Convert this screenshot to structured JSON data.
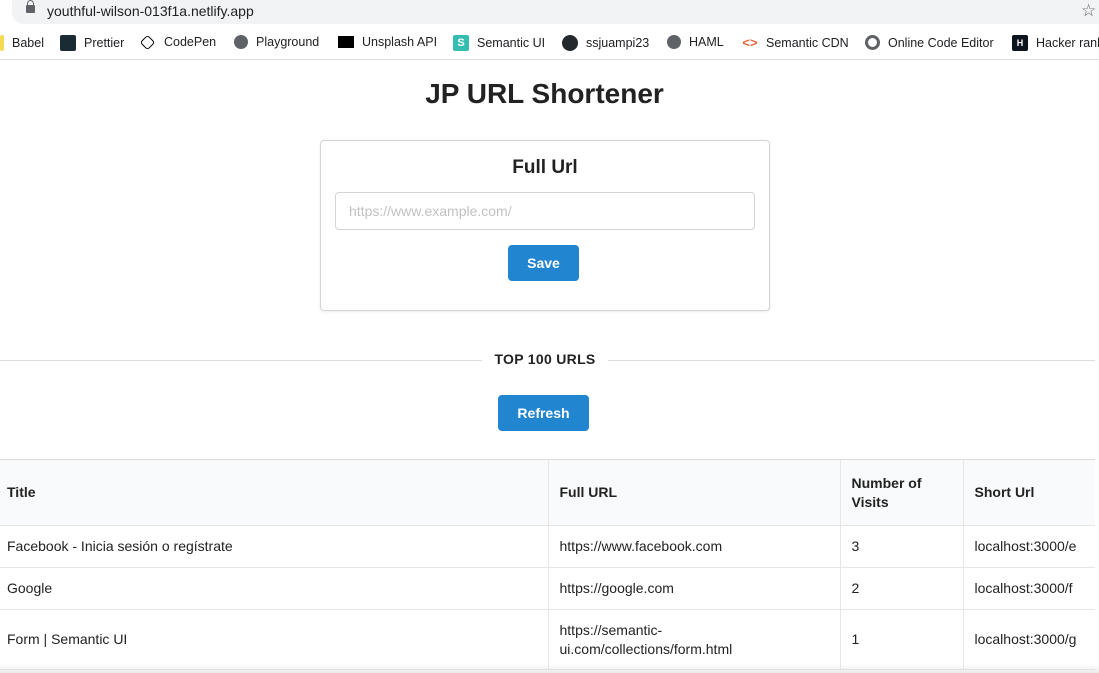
{
  "browser": {
    "url": "youthful-wilson-013f1a.netlify.app",
    "bookmarks": [
      {
        "label": "Babel",
        "icon": "babel-icon"
      },
      {
        "label": "Prettier",
        "icon": "prettier-icon"
      },
      {
        "label": "CodePen",
        "icon": "codepen-icon"
      },
      {
        "label": "Playground",
        "icon": "globe-icon"
      },
      {
        "label": "Unsplash API",
        "icon": "unsplash-icon"
      },
      {
        "label": "Semantic UI",
        "icon": "semantic-ui-icon"
      },
      {
        "label": "ssjuampi23",
        "icon": "github-icon"
      },
      {
        "label": "HAML",
        "icon": "globe-icon"
      },
      {
        "label": "Semantic CDN",
        "icon": "code-brackets-icon"
      },
      {
        "label": "Online Code Editor",
        "icon": "online-editor-icon"
      },
      {
        "label": "Hacker rank",
        "icon": "hackerrank-icon"
      }
    ]
  },
  "header": {
    "title": "JP URL Shortener"
  },
  "form": {
    "title": "Full Url",
    "placeholder": "https://www.example.com/",
    "value": "",
    "save_label": "Save"
  },
  "divider": {
    "label": "TOP 100 URLS"
  },
  "refresh_label": "Refresh",
  "table": {
    "columns": [
      "Title",
      "Full URL",
      "Number of Visits",
      "Short Url"
    ],
    "rows": [
      {
        "title": "Facebook - Inicia sesión o regístrate",
        "full_url": "https://www.facebook.com",
        "visits": "3",
        "short_url": "localhost:3000/e"
      },
      {
        "title": "Google",
        "full_url": "https://google.com",
        "visits": "2",
        "short_url": "localhost:3000/f"
      },
      {
        "title": "Form | Semantic UI",
        "full_url": "https://semantic-ui.com/collections/form.html",
        "visits": "1",
        "short_url": "localhost:3000/g"
      }
    ]
  },
  "colors": {
    "primary_button": "#2185d0",
    "table_header_bg": "#f9fafb"
  }
}
